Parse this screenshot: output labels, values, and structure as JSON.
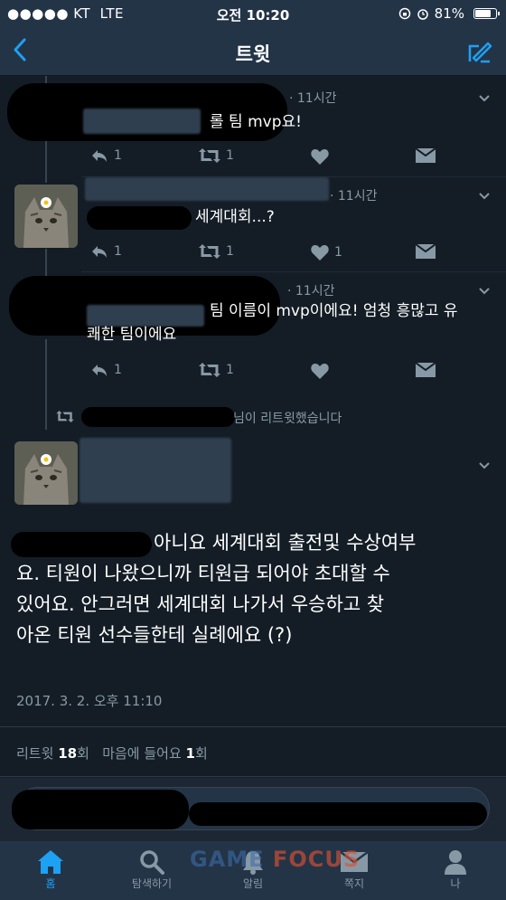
{
  "status_bar": {
    "carrier": "●●●●● KT",
    "network": "LTE",
    "time": "오전 10:20",
    "battery": "81%",
    "battery_level": 0.81
  },
  "header": {
    "title": "트윗",
    "back_icon": "chevron-left-icon",
    "compose_icon": "compose-icon"
  },
  "thread": [
    {
      "time": "· 11시간",
      "text_lines": [
        "롤 팀 mvp요!"
      ],
      "reply_count": "1",
      "retweet_count": "1",
      "like_count": ""
    },
    {
      "time": "· 11시간",
      "text_lines": [
        "세계대회...?"
      ],
      "reply_count": "1",
      "retweet_count": "1",
      "like_count": "1"
    },
    {
      "time": "· 11시간",
      "text_lines": [
        "팀 이름이 mvp이에요! 엄청 흥많고 유",
        "쾌한 팀이에요"
      ],
      "reply_count": "1",
      "retweet_count": "1",
      "like_count": ""
    }
  ],
  "retweet_notice": "님이 리트윗했습니다",
  "main_tweet": {
    "text_lines": [
      "아니요 세계대회 출전및 수상여부",
      "요. 티원이 나왔으니까 티원급 되어야 초대할 수",
      "있어요. 안그러면 세계대회 나가서 우승하고 찾",
      "아온 티원 선수들한테 실례에요 (?)"
    ],
    "timestamp": "2017. 3. 2. 오후 11:10",
    "stats": {
      "retweet_label": "리트윗",
      "retweet_count": "18",
      "retweet_unit": "회",
      "like_label": "마음에 들어요",
      "like_count": "1",
      "like_unit": "회"
    }
  },
  "tabs": [
    {
      "label": "홈",
      "icon": "home-icon",
      "active": true
    },
    {
      "label": "탐색하기",
      "icon": "search-icon",
      "active": false
    },
    {
      "label": "알림",
      "icon": "bell-icon",
      "active": false
    },
    {
      "label": "쪽지",
      "icon": "envelope-icon",
      "active": false
    },
    {
      "label": "나",
      "icon": "person-icon",
      "active": false
    }
  ],
  "watermark": {
    "game": "GAME",
    "focus": "FOCUS"
  },
  "colors": {
    "background": "#141d26",
    "bar": "#243447",
    "accent": "#1da1f2",
    "muted": "#8899a6"
  }
}
